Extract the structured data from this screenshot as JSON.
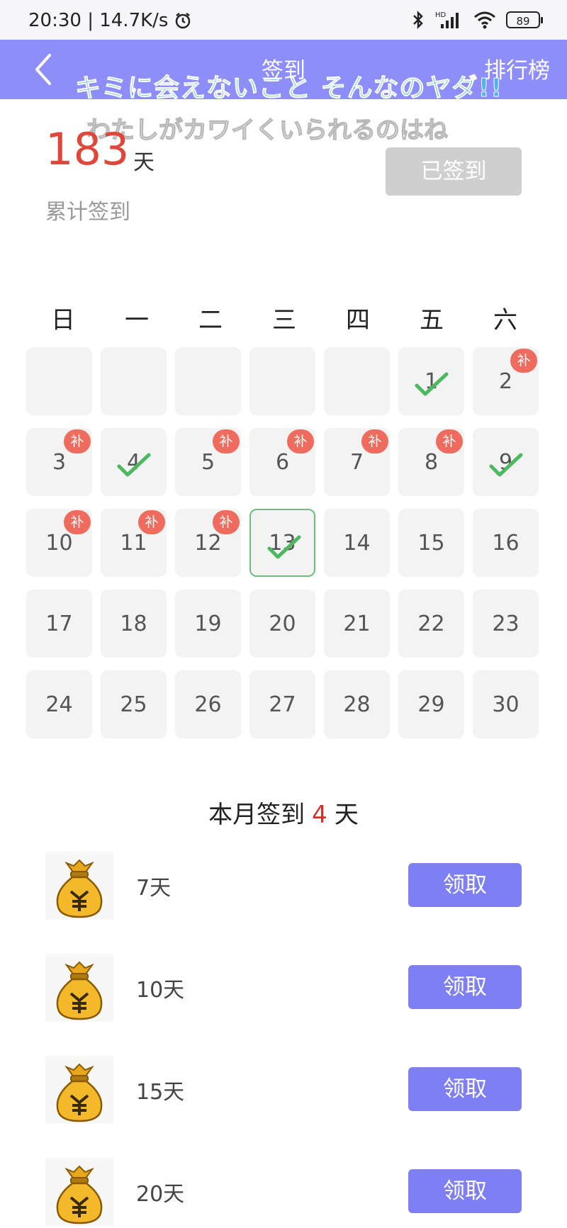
{
  "status_bar": {
    "time_speed": "20:30 | 14.7K/s",
    "battery": "89",
    "signal_label": "HD"
  },
  "header": {
    "title": "签到",
    "ranking_label": "排行榜"
  },
  "overlay": {
    "line1": "キミに会えないこと そんなのヤダ!!",
    "line2": "わたしがカワイくいられるのはね"
  },
  "summary": {
    "total_days": "183",
    "unit": "天",
    "label": "累计签到",
    "signed_button": "已签到"
  },
  "calendar": {
    "weekdays": [
      "日",
      "一",
      "二",
      "三",
      "四",
      "五",
      "六"
    ],
    "days": [
      {
        "day": "",
        "empty": true
      },
      {
        "day": "",
        "empty": true
      },
      {
        "day": "",
        "empty": true
      },
      {
        "day": "",
        "empty": true
      },
      {
        "day": "",
        "empty": true
      },
      {
        "day": "1",
        "checked": true
      },
      {
        "day": "2",
        "badge": "补"
      },
      {
        "day": "3",
        "badge": "补"
      },
      {
        "day": "4",
        "checked": true
      },
      {
        "day": "5",
        "badge": "补"
      },
      {
        "day": "6",
        "badge": "补"
      },
      {
        "day": "7",
        "badge": "补"
      },
      {
        "day": "8",
        "badge": "补"
      },
      {
        "day": "9",
        "checked": true
      },
      {
        "day": "10",
        "badge": "补"
      },
      {
        "day": "11",
        "badge": "补"
      },
      {
        "day": "12",
        "badge": "补"
      },
      {
        "day": "13",
        "checked": true,
        "today": true
      },
      {
        "day": "14"
      },
      {
        "day": "15"
      },
      {
        "day": "16"
      },
      {
        "day": "17"
      },
      {
        "day": "18"
      },
      {
        "day": "19"
      },
      {
        "day": "20"
      },
      {
        "day": "21"
      },
      {
        "day": "22"
      },
      {
        "day": "23"
      },
      {
        "day": "24"
      },
      {
        "day": "25"
      },
      {
        "day": "26"
      },
      {
        "day": "27"
      },
      {
        "day": "28"
      },
      {
        "day": "29"
      },
      {
        "day": "30"
      }
    ]
  },
  "month_summary": {
    "prefix": "本月签到",
    "count": "4",
    "suffix": "天"
  },
  "rewards": [
    {
      "label": "7天",
      "button": "领取"
    },
    {
      "label": "10天",
      "button": "领取"
    },
    {
      "label": "15天",
      "button": "领取"
    },
    {
      "label": "20天",
      "button": "领取"
    }
  ],
  "colors": {
    "header_bg": "#8e8efa",
    "accent_red": "#e0463a",
    "badge_red": "#ef6b5e",
    "check_green": "#4cb85f",
    "button_purple": "#7f7ff5"
  }
}
